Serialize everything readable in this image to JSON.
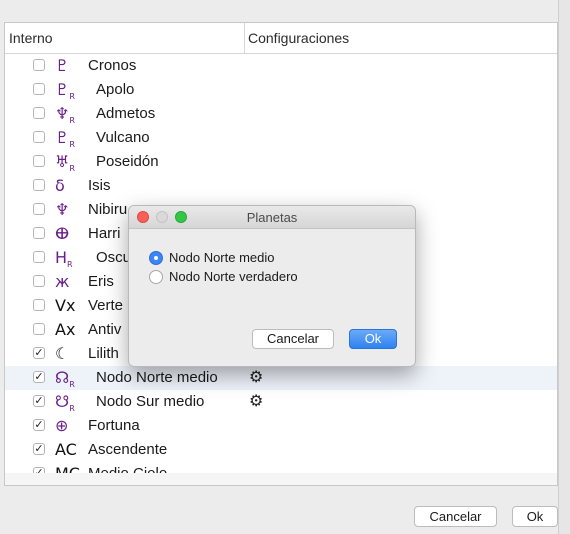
{
  "list": {
    "columns": [
      "Interno",
      "Configuraciones"
    ],
    "rows": [
      {
        "glyph": "♇",
        "name": "Cronos",
        "checked": false,
        "indent": false,
        "retro": false,
        "gear": false
      },
      {
        "glyph": "♇",
        "name": "Apolo",
        "checked": false,
        "indent": true,
        "retro": true,
        "gear": false
      },
      {
        "glyph": "♆",
        "name": "Admetos",
        "checked": false,
        "indent": true,
        "retro": true,
        "gear": false
      },
      {
        "glyph": "♇",
        "name": "Vulcano",
        "checked": false,
        "indent": true,
        "retro": true,
        "gear": false
      },
      {
        "glyph": "♅",
        "name": "Poseidón",
        "checked": false,
        "indent": true,
        "retro": true,
        "gear": false
      },
      {
        "glyph": "δ",
        "name": "Isis",
        "checked": false,
        "indent": false,
        "retro": false,
        "gear": false
      },
      {
        "glyph": "♆",
        "name": "Nibiru",
        "checked": false,
        "indent": false,
        "retro": false,
        "gear": false
      },
      {
        "glyph": "ⴲ",
        "name": "Harri",
        "checked": false,
        "indent": false,
        "retro": false,
        "gear": false
      },
      {
        "glyph": "H",
        "name": "Oscu",
        "checked": false,
        "indent": true,
        "retro": true,
        "gear": false
      },
      {
        "glyph": "ж",
        "name": "Eris",
        "checked": false,
        "indent": false,
        "retro": false,
        "gear": false
      },
      {
        "glyph": "Vx",
        "name": "Verte",
        "checked": false,
        "indent": false,
        "retro": false,
        "gear": false,
        "black": true
      },
      {
        "glyph": "Ax",
        "name": "Antiv",
        "checked": false,
        "indent": false,
        "retro": false,
        "gear": false,
        "black": true
      },
      {
        "glyph": "☾",
        "name": "Lilith",
        "checked": true,
        "indent": false,
        "retro": false,
        "gear": false,
        "black": true
      },
      {
        "glyph": "☊",
        "name": "Nodo Norte medio",
        "checked": true,
        "indent": true,
        "retro": true,
        "gear": true,
        "selected": true
      },
      {
        "glyph": "☋",
        "name": "Nodo Sur medio",
        "checked": true,
        "indent": true,
        "retro": true,
        "gear": true
      },
      {
        "glyph": "⊕",
        "name": "Fortuna",
        "checked": true,
        "indent": false,
        "retro": false,
        "gear": false
      },
      {
        "glyph": "AC",
        "name": "Ascendente",
        "checked": true,
        "indent": false,
        "retro": false,
        "gear": false,
        "black": true
      },
      {
        "glyph": "MC",
        "name": "Medio Cielo",
        "checked": true,
        "indent": false,
        "retro": false,
        "gear": false,
        "black": true
      }
    ],
    "retro_mark": "R",
    "check_mark": "✓",
    "gear_icon": "⚙"
  },
  "footer": {
    "cancel": "Cancelar",
    "ok": "Ok"
  },
  "dialog": {
    "title": "Planetas",
    "options": [
      {
        "label": "Nodo Norte medio",
        "selected": true
      },
      {
        "label": "Nodo Norte verdadero",
        "selected": false
      }
    ],
    "cancel": "Cancelar",
    "ok": "Ok"
  },
  "colors": {
    "glyph_purple": "#6a1e8a",
    "accent_blue": "#3a86f5"
  }
}
